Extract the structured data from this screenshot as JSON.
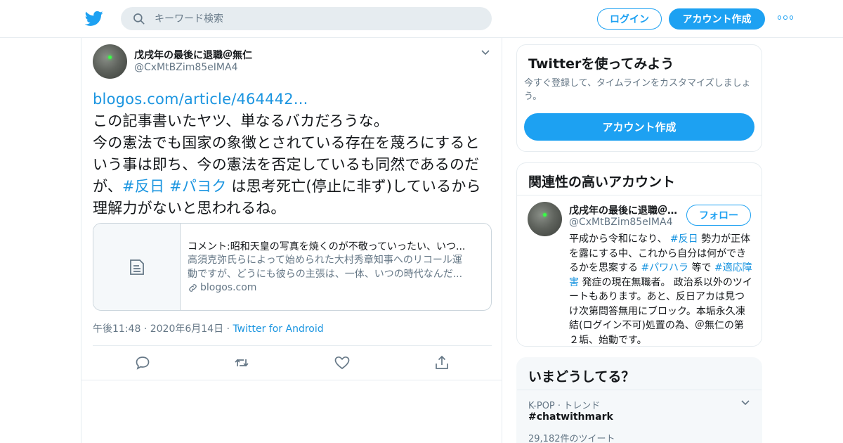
{
  "header": {
    "search_placeholder": "キーワード検索",
    "login_label": "ログイン",
    "signup_label": "アカウント作成"
  },
  "tweet": {
    "author_name": "戊戌年の最後に退職＠無仁",
    "author_handle": "@CxMtBZim85eIMA4",
    "link": "blogos.com/article/464442...",
    "text_1": "この記事書いたヤツ、単なるバカだろうな。",
    "text_2": "今の憲法でも国家の象徴とされている存在を蔑ろにするという事は即ち、今の憲法を否定しているも同然であるのだが、",
    "hashtag_1": "#反日",
    "hashtag_2": "#パヨク",
    "text_3": "は思考死亡(停止に非ず)しているから理解力がないと思われるね。",
    "card": {
      "title": "コメント:昭和天皇の写真を焼くのが不敬っていったい、いつ...",
      "desc_1": "高須克弥氏らによって始められた大村秀章知事へのリコール運",
      "desc_2": "動ですが、どうにも彼らの主張は、一体、いつの時代なんだ...",
      "domain": "blogos.com"
    },
    "time": "午後11:48",
    "date": "2020年6月14日",
    "source": "Twitter for Android"
  },
  "sidebar": {
    "signup_panel": {
      "title": "Twitterを使ってみよう",
      "subtitle": "今すぐ登録して、タイムラインをカスタマイズしましょう。",
      "button_label": "アカウント作成"
    },
    "related": {
      "title": "関連性の高いアカウント",
      "name": "戊戌年の最後に退職＠無仁",
      "handle": "@CxMtBZim85eIMA4",
      "follow_label": "フォロー",
      "bio_1": "平成から令和になり、",
      "bio_tag_1": "#反日",
      "bio_2": "勢力が正体を露にする中、これから自分は何ができるかを思案する",
      "bio_tag_2": "#パワハラ",
      "bio_3": "等で",
      "bio_tag_3": "#適応障害",
      "bio_4": "発症の現在無職者。 政治系以外のツイートもあります。あと、反日アカは見つけ次第問答無用にブロック。本垢永久凍結(ログイン不可)処置の為、＠無仁の第２垢、始動です。"
    },
    "trends": {
      "title": "いまどうしてる？",
      "meta_category": "K-POP",
      "meta_label": "トレンド",
      "name": "#chatwithmark",
      "count": "29,182件のツイート"
    }
  },
  "colors": {
    "accent": "#1da1f2",
    "link": "#1b95e0",
    "secondary_text": "#657786",
    "border": "#e6ecf0"
  }
}
